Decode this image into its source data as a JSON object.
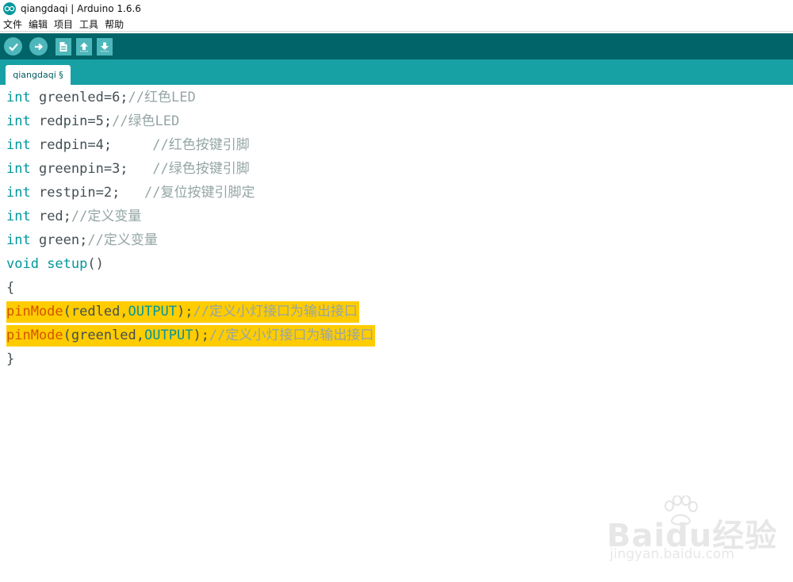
{
  "window": {
    "title": "qiangdaqi | Arduino 1.6.6"
  },
  "menu": [
    {
      "label": "文件"
    },
    {
      "label": "编辑"
    },
    {
      "label": "项目"
    },
    {
      "label": "工具"
    },
    {
      "label": "帮助"
    }
  ],
  "toolbar": {
    "verify_icon": "check-icon",
    "upload_icon": "arrow-right-icon",
    "new_icon": "document-icon",
    "open_icon": "arrow-up-icon",
    "save_icon": "arrow-down-icon"
  },
  "tab": {
    "label": "qiangdaqi §"
  },
  "code": {
    "line1": {
      "kw": "int",
      "body": " greenled=6;",
      "comment": "//红色LED"
    },
    "line2": {
      "kw": "int",
      "body": " redpin=5;",
      "comment": "//绿色LED"
    },
    "line3": {
      "kw": "int",
      "body": " redpin=4;     ",
      "comment": "//红色按键引脚"
    },
    "line4": {
      "kw": "int",
      "body": " greenpin=3;   ",
      "comment": "//绿色按键引脚"
    },
    "line5": {
      "kw": "int",
      "body": " restpin=2;   ",
      "comment": "//复位按键引脚定"
    },
    "line6": {
      "kw": "int",
      "body": " red;",
      "comment": "//定义变量"
    },
    "line7": {
      "kw": "int",
      "body": " green;",
      "comment": "//定义变量"
    },
    "line8": {
      "kw": "void",
      "fn": " setup",
      "body": "()"
    },
    "line9": {
      "body": "{"
    },
    "line10": {
      "fn": "pinMode",
      "body1": "(redled,",
      "const": "OUTPUT",
      "body2": ");",
      "comment": "//定义小灯接口为输出接口"
    },
    "line11": {
      "fn": "pinMode",
      "body1": "(greenled,",
      "const": "OUTPUT",
      "body2": ");",
      "comment": "//定义小灯接口为输出接口"
    },
    "line12": {
      "body": "}"
    }
  },
  "watermark": {
    "logo": "Baidu经验",
    "url": "jingyan.baidu.com"
  },
  "colors": {
    "toolbar_bg": "#006468",
    "tabstrip_bg": "#17a1a5",
    "button_bg": "#4db7bb",
    "highlight": "#ffcc00",
    "keyword": "#00979c",
    "function": "#d35400",
    "comment": "#95a5a6"
  }
}
